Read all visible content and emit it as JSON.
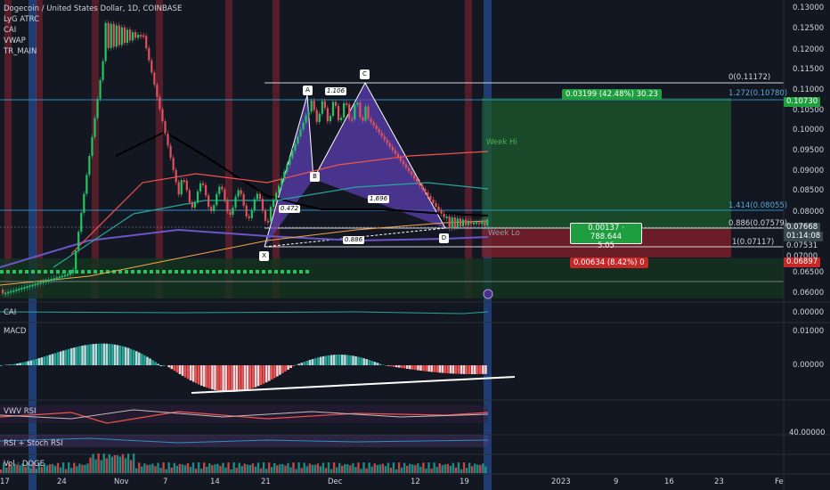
{
  "header": {
    "symbol_title": "Dogecoin / United States Dollar, 1D, COINBASE",
    "indicators": [
      "LyG ATRC",
      "CAI",
      "VWAP",
      "TR_MAIN"
    ]
  },
  "price_axis": {
    "ticks": [
      "0.13000",
      "0.12500",
      "0.12000",
      "0.11500",
      "0.11000",
      "0.10500",
      "0.10000",
      "0.09500",
      "0.09000",
      "0.08500",
      "0.08000",
      "0.07000",
      "0.06500",
      "0.06000"
    ],
    "last_price": "0.07668",
    "countdown": "01:14:08",
    "target_price": "0.10730",
    "level_price_1": "0.07531",
    "level_price_2": "0.07000",
    "stop_price": "0.06897"
  },
  "time_axis": {
    "ticks": [
      "17",
      "24",
      "Nov",
      "7",
      "14",
      "21",
      "Dec",
      "12",
      "19",
      "2023",
      "9",
      "16",
      "23",
      "Fe"
    ]
  },
  "harmonic": {
    "points": [
      "X",
      "A",
      "B",
      "C",
      "D"
    ],
    "ratios": [
      "1.106",
      "0.472",
      "1.696",
      "0.886"
    ]
  },
  "fib_levels": {
    "level_0": "0(0.11172)",
    "level_1272": "1.272(0.10780)",
    "level_1414": "1.414(0.08055)",
    "level_0886": "0.886(0.07579)",
    "level_1": "1(0.07117)"
  },
  "zones": {
    "week_hi": "Week Hi",
    "week_lo": "Week Lo"
  },
  "position": {
    "target_label": "0.03199 (42.48%) 30.23",
    "entry_label_1": "0.00137 · 788.644",
    "entry_label_2": "5.05",
    "stop_label": "0.00634 (8.42%) 0"
  },
  "panes": {
    "cai": {
      "name": "CAI",
      "value": "0.00000"
    },
    "macd": {
      "name": "MACD",
      "ticks": [
        "0.01000",
        "0.00000"
      ]
    },
    "vwv_rsi": {
      "name": "VWV RSI"
    },
    "rsi_stoch": {
      "name": "RSI + Stoch RSI",
      "value": "40.00000"
    },
    "volume": {
      "name": "Vol · DOGE"
    }
  },
  "colors": {
    "background": "#131722",
    "up": "#26a69a",
    "down": "#ef5350",
    "harmonic_fill": "#5b3fb0",
    "target_zone": "#1e5b2d",
    "stop_zone": "#7a1f28"
  }
}
